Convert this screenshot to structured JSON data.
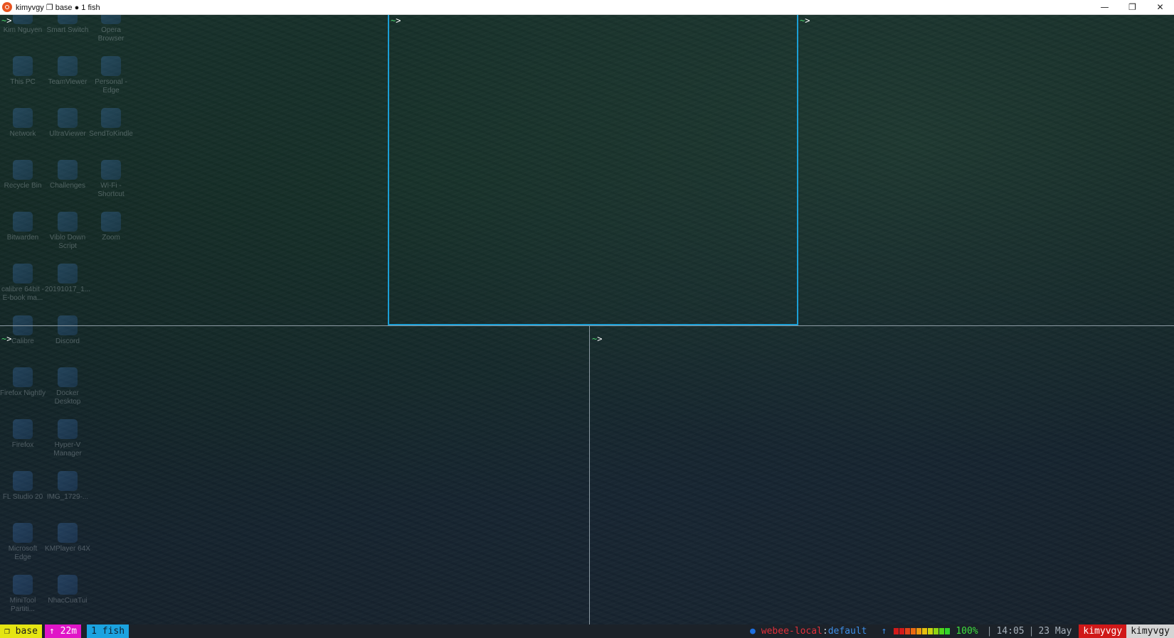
{
  "window": {
    "title": "kimyvgy ❐ base ● 1 fish",
    "controls": [
      "—",
      "❐",
      "✕"
    ]
  },
  "desktop_icons": [
    "Kim Nguyen",
    "Smart Switch",
    "Opera Browser",
    "This PC",
    "TeamViewer",
    "Personal - Edge",
    "Network",
    "UltraViewer",
    "SendToKindle",
    "Recycle Bin",
    "Challenges",
    "Wi-Fi - Shortcut",
    "Bitwarden",
    "Viblo Down Script",
    "Zoom",
    "calibre 64bit - E-book ma...",
    "20191017_1...",
    "Calibre",
    "Discord",
    "Firefox Nightly",
    "Docker Desktop",
    "Firefox",
    "Hyper-V Manager",
    "FL Studio 20",
    "IMG_1729-...",
    "Microsoft Edge",
    "KMPlayer 64X",
    "MiniTool Partiti...",
    "NhacCuaTui"
  ],
  "panes": [
    {
      "tilde": "~",
      "arrow": ">"
    },
    {
      "tilde": "~",
      "arrow": ">"
    },
    {
      "tilde": "~",
      "arrow": ">"
    },
    {
      "tilde": "~",
      "arrow": ">"
    },
    {
      "tilde": "~",
      "arrow": ">"
    }
  ],
  "status": {
    "session": "❐ base",
    "uptime": "↑ 22m",
    "window": "1 fish",
    "dot": "●",
    "host": "webee-local",
    "colon": ":",
    "context": "default",
    "up_arrow": "↑",
    "battery_percent_text": "100%",
    "battery_level": 1.0,
    "battery_colors": [
      "#d21a1a",
      "#d21a1a",
      "#e0431a",
      "#e86a12",
      "#ec9a0e",
      "#e6c00e",
      "#c9d40e",
      "#8fd414",
      "#4fd41c",
      "#2fd42a"
    ],
    "sep": "|",
    "time": "14:05",
    "date": "23 May",
    "user1": "kimyvgy",
    "user2": "kimyvgy"
  },
  "colors": {
    "active_pane_border": "#1b9fd6",
    "prompt_tilde": "#4ad66d",
    "session_bg": "#e5e513",
    "uptime_bg": "#e015c7",
    "window_bg": "#1ba3e0",
    "user_bg": "#d01818"
  }
}
